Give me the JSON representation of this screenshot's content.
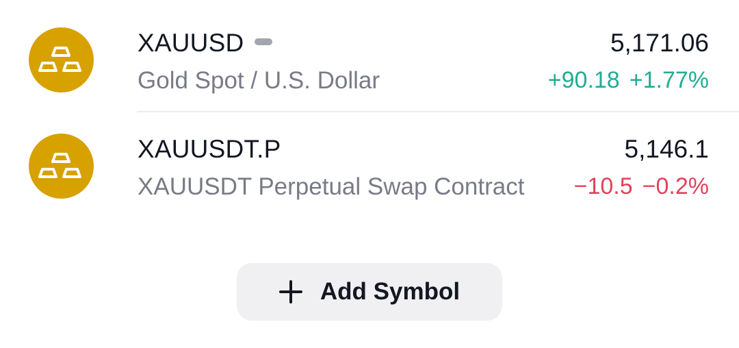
{
  "watchlist": {
    "items": [
      {
        "symbol": "XAUUSD",
        "description": "Gold Spot / U.S. Dollar",
        "price": "5,171.06",
        "change": "+90.18",
        "change_percent": "+1.77%",
        "direction": "up",
        "icon": "gold-bars-icon",
        "icon_color": "#d7a100"
      },
      {
        "symbol": "XAUUSDT.P",
        "description": "XAUUSDT Perpetual Swap Contract",
        "price": "5,146.1",
        "change": "−10.5",
        "change_percent": "−0.2%",
        "direction": "down",
        "icon": "gold-bars-icon",
        "icon_color": "#d7a100"
      }
    ],
    "add_button": {
      "label": "Add Symbol",
      "icon": "plus-icon"
    },
    "colors": {
      "up": "#22ab94",
      "down": "#e0435a",
      "text": "#131722",
      "muted": "#787b86"
    }
  }
}
